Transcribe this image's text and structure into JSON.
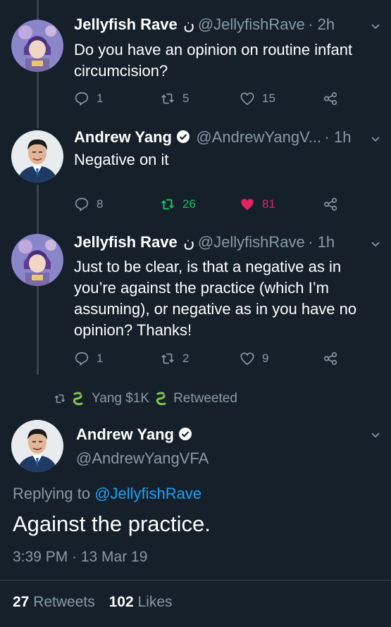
{
  "tweets": [
    {
      "name": "Jellyfish Rave",
      "name_glyph": "ن",
      "handle": "@JellyfishRave",
      "time": "· 2h",
      "text": "Do you have an opinion on routine infant circumcision?",
      "replies": "1",
      "retweets": "5",
      "likes": "15"
    },
    {
      "name": "Andrew Yang",
      "handle": "@AndrewYangV...",
      "time": "· 1h",
      "text": "Negative on it",
      "replies": "8",
      "retweets": "26",
      "likes": "81",
      "retweeted": true,
      "liked": true
    },
    {
      "name": "Jellyfish Rave",
      "name_glyph": "ن",
      "handle": "@JellyfishRave",
      "time": "· 1h",
      "text": "Just to be clear, is that a negative as in you’re against the practice (which I’m assuming), or negative as in you have no opinion? Thanks!",
      "replies": "1",
      "retweets": "2",
      "likes": "9"
    }
  ],
  "retweet_context": {
    "text": "Yang $1K",
    "suffix": "Retweeted"
  },
  "main_tweet": {
    "name": "Andrew Yang",
    "handle": "@AndrewYangVFA",
    "replying_prefix": "Replying to",
    "replying_handle": "@JellyfishRave",
    "text": "Against the practice.",
    "timestamp": "3:39 PM · 13 Mar 19",
    "retweet_count": "27",
    "retweet_label": "Retweets",
    "like_count": "102",
    "like_label": "Likes"
  },
  "colors": {
    "background": "#15202b",
    "muted": "#8899a6",
    "link": "#1da1f2",
    "retweet_green": "#17bf63",
    "like_pink": "#e0245e"
  },
  "icons": [
    "reply-icon",
    "retweet-icon",
    "heart-icon",
    "share-icon",
    "verified-icon",
    "chevron-down-icon",
    "dragon-icon"
  ]
}
